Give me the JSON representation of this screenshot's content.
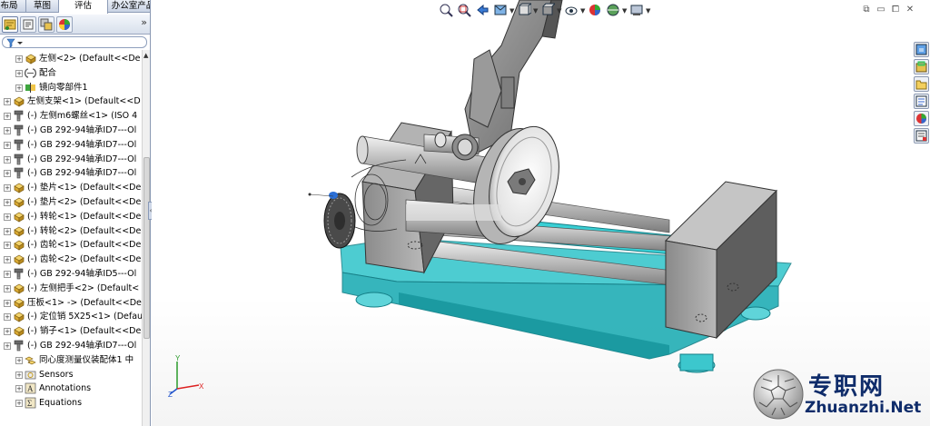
{
  "command_manager": {
    "tabs": [
      {
        "label": "布局"
      },
      {
        "label": "草图"
      },
      {
        "label": "评估",
        "active": true
      },
      {
        "label": "办公室产品"
      }
    ]
  },
  "feature_manager": {
    "tab_icons": [
      "feature-manager-tree-icon",
      "property-manager-icon",
      "configuration-manager-icon",
      "display-manager-icon"
    ],
    "expand_glyph": "»",
    "filter_icon": "filter-funnel-icon",
    "tree": [
      {
        "label": "左侧<2> (Default<<De",
        "icon": "part-icon",
        "indent": 1
      },
      {
        "label": "配合",
        "icon": "mates-icon",
        "indent": 1
      },
      {
        "label": "镜向零部件1",
        "icon": "mirror-component-icon",
        "indent": 1
      },
      {
        "label": "左侧支架<1> (Default<<D",
        "icon": "part-icon",
        "indent": 0
      },
      {
        "label": "(-) 左侧m6螺丝<1> (ISO 4",
        "icon": "toolbox-part-icon",
        "indent": 0
      },
      {
        "label": "(-) GB 292-94轴承ID7---Ol",
        "icon": "toolbox-part-icon",
        "indent": 0
      },
      {
        "label": "(-) GB 292-94轴承ID7---Ol",
        "icon": "toolbox-part-icon",
        "indent": 0
      },
      {
        "label": "(-) GB 292-94轴承ID7---Ol",
        "icon": "toolbox-part-icon",
        "indent": 0
      },
      {
        "label": "(-) GB 292-94轴承ID7---Ol",
        "icon": "toolbox-part-icon",
        "indent": 0
      },
      {
        "label": "(-) 垫片<1> (Default<<De",
        "icon": "part-icon",
        "indent": 0
      },
      {
        "label": "(-) 垫片<2> (Default<<De",
        "icon": "part-icon",
        "indent": 0
      },
      {
        "label": "(-) 转轮<1> (Default<<De",
        "icon": "part-icon",
        "indent": 0
      },
      {
        "label": "(-) 转轮<2> (Default<<De",
        "icon": "part-icon",
        "indent": 0
      },
      {
        "label": "(-) 齿轮<1> (Default<<De",
        "icon": "part-icon",
        "indent": 0
      },
      {
        "label": "(-) 齿轮<2> (Default<<De",
        "icon": "part-icon",
        "indent": 0
      },
      {
        "label": "(-) GB 292-94轴承ID5---Ol",
        "icon": "toolbox-part-icon",
        "indent": 0
      },
      {
        "label": "(-) 左侧把手<2> (Default<",
        "icon": "part-icon",
        "indent": 0
      },
      {
        "label": "压板<1> -> (Default<<De",
        "icon": "part-icon",
        "indent": 0
      },
      {
        "label": "(-) 定位销 5X25<1> (Defau",
        "icon": "part-icon",
        "indent": 0
      },
      {
        "label": "(-) 销子<1> (Default<<De",
        "icon": "part-icon",
        "indent": 0
      },
      {
        "label": "(-) GB 292-94轴承ID7---Ol",
        "icon": "toolbox-part-icon",
        "indent": 0
      },
      {
        "label": "同心度测量仪装配体1 中",
        "icon": "assembly-icon",
        "indent": 1
      },
      {
        "label": "Sensors",
        "icon": "sensors-icon",
        "indent": 1
      },
      {
        "label": "Annotations",
        "icon": "annotations-icon",
        "indent": 1
      },
      {
        "label": "Equations",
        "icon": "equations-icon",
        "indent": 1
      }
    ]
  },
  "heads_up_toolbar": {
    "buttons": [
      "zoom-to-fit-icon",
      "zoom-to-area-icon",
      "previous-view-icon",
      "section-view-icon",
      "view-orientation-icon",
      "display-style-icon",
      "hide-show-items-icon",
      "edit-appearance-icon",
      "apply-scene-icon",
      "view-settings-icon"
    ]
  },
  "window_controls": [
    "restore-down-icon",
    "minimize-icon",
    "maximize-icon",
    "close-icon"
  ],
  "task_pane": [
    "solidworks-resources-icon",
    "design-library-icon",
    "file-explorer-icon",
    "view-palette-icon",
    "appearances-scenes-icon",
    "custom-properties-icon"
  ],
  "triad": {
    "x": "X",
    "y": "Y",
    "z": "Z"
  },
  "watermark": {
    "cn": "专职网",
    "en": "Zhuanzhi.Net"
  },
  "colors": {
    "base_plate": "#1fb0b8",
    "metal": "#c8c8c8",
    "dark_metal": "#6e6e6e",
    "selection_blue": "#2b6fd6"
  }
}
